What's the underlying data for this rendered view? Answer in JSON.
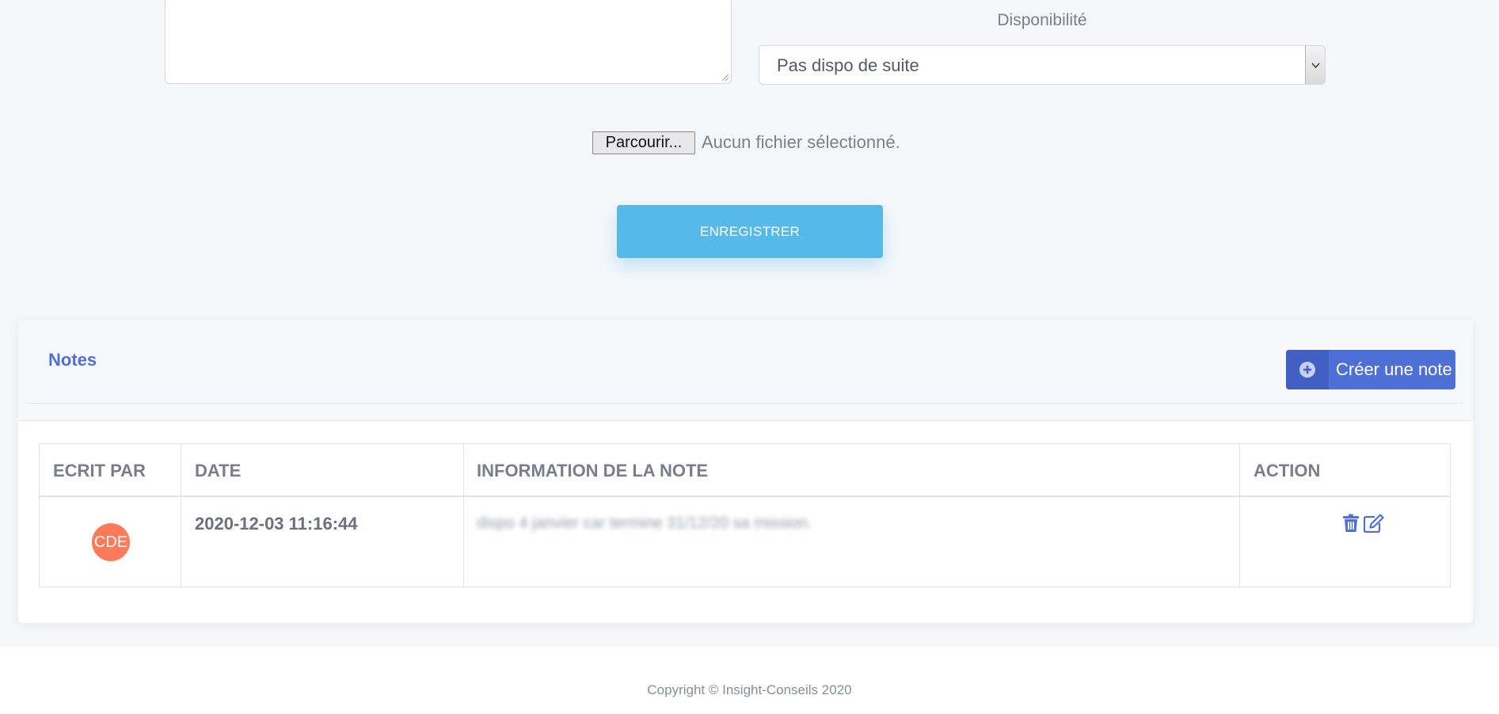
{
  "form": {
    "availability_label": "Disponibilité",
    "availability_value": "Pas dispo de suite",
    "file_button_label": "Parcourir...",
    "file_status": "Aucun fichier sélectionné.",
    "save_label": "ENREGISTRER"
  },
  "notes": {
    "title": "Notes",
    "create_label": "Créer une note",
    "columns": [
      "ECRIT PAR",
      "DATE",
      "INFORMATION DE LA NOTE",
      "ACTION"
    ],
    "rows": [
      {
        "author_initials": "CDE",
        "date": "2020-12-03 11:16:44",
        "info": "dispo 4 janvier car termine 31/12/20 sa mission."
      }
    ]
  },
  "colors": {
    "accent": "#4d6fd6",
    "save_button": "#56b9ea",
    "avatar": "#ff7a59"
  },
  "footer": {
    "copyright": "Copyright © Insight-Conseils 2020"
  }
}
